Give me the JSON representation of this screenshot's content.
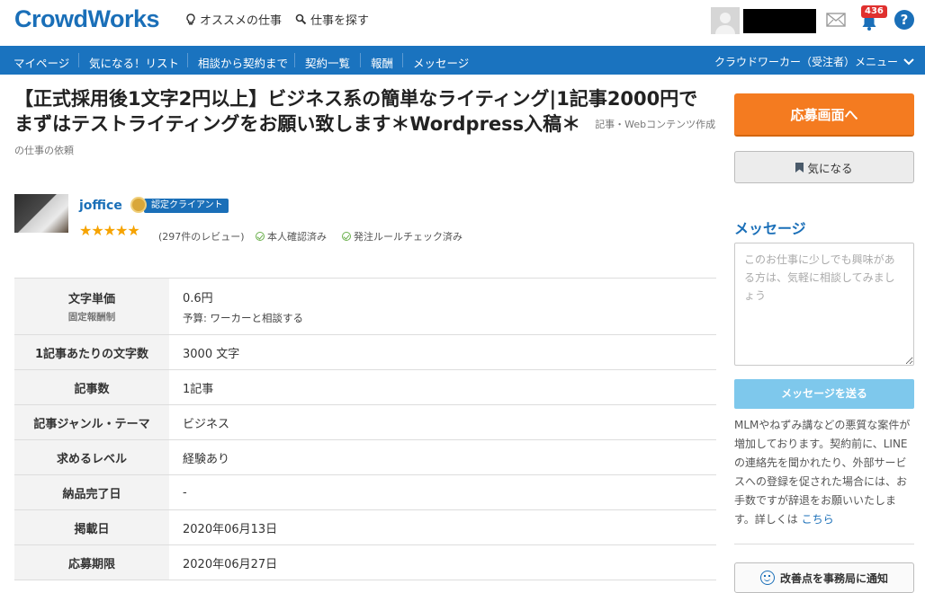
{
  "header": {
    "logo": "CrowdWorks",
    "recommended_label": "オススメの仕事",
    "search_label": "仕事を探す",
    "notification_count": "436",
    "help_label": "?"
  },
  "nav": {
    "items": [
      "マイページ",
      "気になる！リスト",
      "相談から契約まで",
      "契約一覧",
      "報酬",
      "メッセージ"
    ],
    "menu_label": "クラウドワーカー（受注者）メニュー"
  },
  "job": {
    "title": "【正式採用後1文字2円以上】ビジネス系の簡単なライティング|1記事2000円でまずはテストライティングをお願い致します＊Wordpress入稿＊",
    "category": "記事・Webコンテンツ作成の仕事の依頼"
  },
  "client": {
    "name": "joffice",
    "badge": "認定クライアント",
    "stars": "★★★★★",
    "reviews": "(297件のレビュー)",
    "identity_check": "本人確認済み",
    "order_rule_check": "発注ルールチェック済み"
  },
  "details": {
    "rows": [
      {
        "label": "文字単価",
        "sublabel": "固定報酬制",
        "value": "0.6円",
        "subvalue": "予算: ワーカーと相談する"
      },
      {
        "label": "1記事あたりの文字数",
        "value": "3000 文字"
      },
      {
        "label": "記事数",
        "value": "1記事"
      },
      {
        "label": "記事ジャンル・テーマ",
        "value": "ビジネス"
      },
      {
        "label": "求めるレベル",
        "value": "経験あり"
      },
      {
        "label": "納品完了日",
        "value": "-"
      },
      {
        "label": "掲載日",
        "value": "2020年06月13日"
      },
      {
        "label": "応募期限",
        "value": "2020年06月27日"
      }
    ]
  },
  "sidebar": {
    "apply_label": "応募画面へ",
    "favorite_label": "気になる",
    "message_heading": "メッセージ",
    "message_placeholder": "このお仕事に少しでも興味がある方は、気軽に相談してみましょう",
    "send_label": "メッセージを送る",
    "warning_text": "MLMやねずみ講などの悪質な案件が増加しております。契約前に、LINEの連絡先を聞かれたり、外部サービスへの登録を促された場合には、お手数ですが辞退をお願いいたします。詳しくは",
    "warning_link": "こちら",
    "report_label": "改善点を事務局に通知"
  },
  "colors": {
    "brand_blue": "#1a73bf",
    "apply_orange": "#f47b20",
    "send_disabled": "#7ec8ec",
    "star": "#f6a300",
    "badge_red": "#e0302e"
  }
}
